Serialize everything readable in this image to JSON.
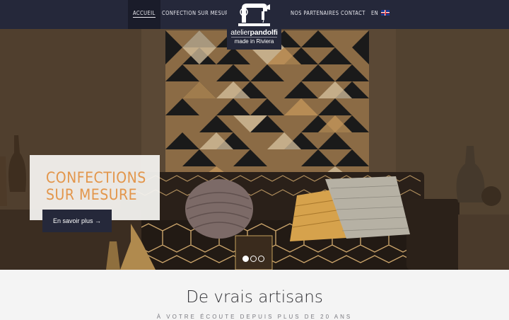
{
  "nav": {
    "items": [
      {
        "label": "Accueil",
        "active": true
      },
      {
        "label": "Confection sur mesure",
        "active": false
      },
      {
        "label": "Nos partenaires",
        "active": false
      },
      {
        "label": "Contact",
        "active": false
      }
    ],
    "language": "EN",
    "language_flag_icon": "uk-flag-icon"
  },
  "logo": {
    "name_light": "atelier",
    "name_bold": "pandolfi",
    "tagline": "made in Riviera",
    "icon": "sewing-machine-icon"
  },
  "hero": {
    "title_line1": "CONFECTIONS",
    "title_line2": "SUR MESURE",
    "button_label": "En savoir plus →",
    "slides": 3,
    "active_slide": 1
  },
  "section": {
    "title": "De vrais artisans",
    "subtitle": "À VOTRE ÉCOUTE DEPUIS PLUS DE 20 ANS"
  },
  "colors": {
    "navbar": "#25283a",
    "accent": "#e3964b",
    "button": "#25283a"
  }
}
